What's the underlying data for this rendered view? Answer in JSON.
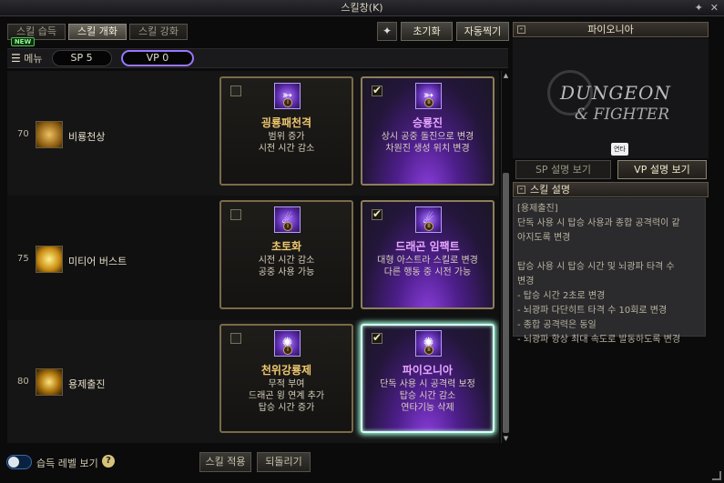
{
  "window": {
    "title": "스킬창(K)",
    "pin_glyph": "✦",
    "close_glyph": "✕"
  },
  "tabs": [
    {
      "label": "스킬 습득",
      "active": false
    },
    {
      "label": "스킬 개화",
      "active": true
    },
    {
      "label": "스킬 강화",
      "active": false
    }
  ],
  "new_badge": "NEW",
  "toolbar": {
    "reset_label": "초기화",
    "auto_label": "자동찍기"
  },
  "menu": {
    "label": "메뉴",
    "sp": "SP 5",
    "vp": "VP 0"
  },
  "skills": [
    {
      "level": "70",
      "name": "비룡천상",
      "left": {
        "checked": false,
        "numeral": "I",
        "title": "굉룡패천격",
        "desc": [
          "범위 증가",
          "시전 시간 감소"
        ]
      },
      "right": {
        "checked": true,
        "numeral": "II",
        "title": "승룡진",
        "desc": [
          "상시 공중 돌진으로 변경",
          "차원진 생성 위치 변경"
        ]
      }
    },
    {
      "level": "75",
      "name": "미티어 버스트",
      "left": {
        "checked": false,
        "numeral": "I",
        "title": "초토화",
        "desc": [
          "시전 시간 감소",
          "공중 사용 가능"
        ]
      },
      "right": {
        "checked": true,
        "numeral": "II",
        "title": "드래곤 임팩트",
        "desc": [
          "대형 아스트라 스킬로 변경",
          "다른 행동 중 시전 가능"
        ]
      }
    },
    {
      "level": "80",
      "name": "용제출진",
      "left": {
        "checked": false,
        "numeral": "I",
        "title": "천위강룡제",
        "desc": [
          "무적 부여",
          "드래곤 윙 연계 추가",
          "탑승 시간 증가"
        ]
      },
      "right": {
        "checked": true,
        "numeral": "II",
        "title": "파이오니아",
        "desc": [
          "단독 사용 시 공격력 보정",
          "탑승 시간 감소",
          "연타기능 삭제"
        ]
      }
    }
  ],
  "bottom": {
    "toggle_label": "습득 레벨 보기",
    "help": "?",
    "apply_label": "스킬 적용",
    "revert_label": "되돌리기"
  },
  "right_panel": {
    "header": "파이오니아",
    "logo_line1": "DUNGEON",
    "logo_line2": "& FIGHTER",
    "tip": "연타",
    "sp_tab": "SP 설명 보기",
    "vp_tab": "VP 설명 보기",
    "section": "스킬 설명",
    "desc_lines": [
      "[용제출진]",
      "단독 사용 시 탑승 사용과 종합 공격력이 같",
      "아지도록 변경",
      "",
      "탑승 사용 시 탑승 시간 및 뇌광파 타격 수",
      "변경",
      "- 탑승 시간 2초로 변경",
      "- 뇌광파 다단히트 타격 수 10회로 변경",
      "- 종합 공격력은 동일",
      "- 뇌광파 항상 최대 속도로 발동하도록 변경"
    ]
  }
}
